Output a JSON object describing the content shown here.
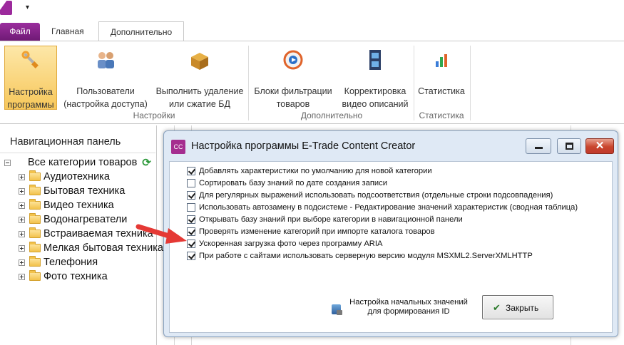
{
  "window": {
    "dialog_title": "Настройка программы E-Trade Content Creator",
    "dialog_icon_text": "CC"
  },
  "tabs": [
    {
      "label": "Файл"
    },
    {
      "label": "Главная"
    },
    {
      "label": "Дополнительно"
    }
  ],
  "ribbon": {
    "buttons": [
      {
        "label": "Настройка программы",
        "icon": "wrench-icon"
      },
      {
        "label": "Пользователи (настройка доступа)",
        "icon": "users-icon"
      },
      {
        "label": "Выполнить удаление или сжатие БД",
        "icon": "box-icon"
      },
      {
        "label": "Блоки фильтрации товаров",
        "icon": "filter-icon"
      },
      {
        "label": "Корректировка видео описаний",
        "icon": "film-icon"
      },
      {
        "label": "Статистика",
        "icon": "chart-icon"
      }
    ],
    "groups": [
      "Настройки",
      "Дополнительно",
      "Статистика"
    ]
  },
  "nav": {
    "title": "Навигационная панель",
    "root": "Все категории товаров",
    "items": [
      "Аудиотехника",
      "Бытовая техника",
      "Видео техника",
      "Водонагреватели",
      "Встраиваемая техника",
      "Мелкая бытовая техника",
      "Телефония",
      "Фото техника"
    ]
  },
  "options": [
    {
      "label": "Добавлять характеристики по умолчанию для новой категории",
      "checked": true
    },
    {
      "label": "Сортировать базу знаний по дате создания записи",
      "checked": false
    },
    {
      "label": "Для регулярных выражений использовать подсоответствия (отдельные строки подсовпадения)",
      "checked": true
    },
    {
      "label": "Использовать автозамену в подсистеме - Редактирование значений характеристик (сводная таблица)",
      "checked": false
    },
    {
      "label": "Открывать базу знаний при выборе категории в навигационной панели",
      "checked": true
    },
    {
      "label": "Проверять изменение категорий при импорте каталога товаров",
      "checked": true
    },
    {
      "label": "Ускоренная загрузка фото через программу ARIA",
      "checked": true
    },
    {
      "label": "При работе с сайтами использовать серверную версию модуля MSXML2.ServerXMLHTTP",
      "checked": true
    }
  ],
  "footer": {
    "initial_values_line1": "Настройка начальных значений",
    "initial_values_line2": "для формирования ID",
    "close_label": "Закрыть"
  },
  "colors": {
    "file_tab": "#7e2485",
    "active_ribbon": "#f7c75a",
    "arrow": "#e53935"
  }
}
